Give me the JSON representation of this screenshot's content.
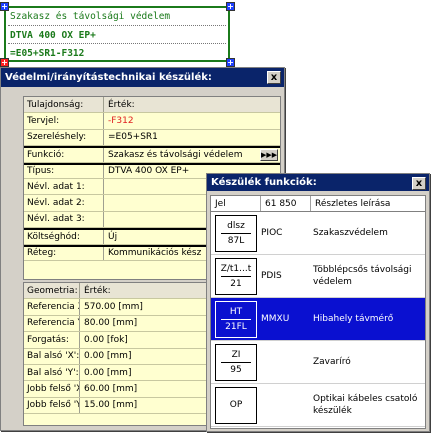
{
  "cad_block": {
    "line1": "Szakasz és távolsági védelem",
    "line2": "DTVA 400 OX EP+",
    "line3": "=E05+SR1-F312"
  },
  "property_window": {
    "title": "Védelmi/irányítástechnikai készülék:",
    "close_label": "x",
    "header": {
      "col1": "Tulajdonság:",
      "col2": "Érték:"
    },
    "rows": [
      {
        "name": "Tervjel:",
        "value": "-F312"
      },
      {
        "name": "Szereléshely:",
        "value": "=E05+SR1"
      },
      {
        "name": "Funkció:",
        "value": "Szakasz és távolsági védelem",
        "button": "▶▶▶"
      },
      {
        "name": "Típus:",
        "value": "DTVA 400 OX EP+"
      },
      {
        "name": "Névl. adat 1:",
        "value": ""
      },
      {
        "name": "Névl. adat 2:",
        "value": ""
      },
      {
        "name": "Névl. adat 3:",
        "value": ""
      },
      {
        "name": "Költséghód:",
        "value": "Új"
      },
      {
        "name": "Réteg:",
        "value": "Kommunikációs kész"
      }
    ],
    "geometry_header": {
      "col1": "Geometria:",
      "col2": "Érték:"
    },
    "geometry_rows": [
      {
        "name": "Referencia X:",
        "value": "570.00 [mm]"
      },
      {
        "name": "Referencia Y:",
        "value": "80.00 [mm]"
      },
      {
        "name": "Forgatás:",
        "value": "0.00 [fok]"
      },
      {
        "name": "Bal alsó 'X':",
        "value": "0.00 [mm]"
      },
      {
        "name": "Bal alsó 'Y':",
        "value": "0.00 [mm]"
      },
      {
        "name": "Jobb felső 'X':",
        "value": "60.00 [mm]"
      },
      {
        "name": "Jobb felső 'Y':",
        "value": "15.00 [mm]"
      }
    ]
  },
  "function_window": {
    "title": "Készülék funkciók:",
    "close_label": "x",
    "header": {
      "col1": "Jel",
      "col2": "61 850",
      "col3": "Részletes leírása"
    },
    "rows": [
      {
        "sym_top": "dlsz",
        "sym_bottom": "87L",
        "code": "PIOC",
        "desc": "Szakaszvédelem",
        "selected": false
      },
      {
        "sym_top": "Z/t1...t",
        "sym_bottom": "21",
        "code": "PDIS",
        "desc": "Többlépcsős távolsági védelem",
        "selected": false
      },
      {
        "sym_top": "HT",
        "sym_bottom": "21FL",
        "code": "MMXU",
        "desc": "Hibahely távmérő",
        "selected": true
      },
      {
        "sym_top": "ZI",
        "sym_bottom": "95",
        "code": "",
        "desc": "Zavaríró",
        "selected": false
      },
      {
        "sym_top": "OP",
        "sym_bottom": "",
        "code": "",
        "desc": "Optikai kábeles csatoló készülék",
        "selected": false
      }
    ]
  },
  "colors": {
    "titlebar": "#0a246a",
    "grid_bg": "#ffffd0",
    "cad_green": "#1b7a1b",
    "selection": "#0a10d0",
    "tervjel_red": "#e02020"
  }
}
